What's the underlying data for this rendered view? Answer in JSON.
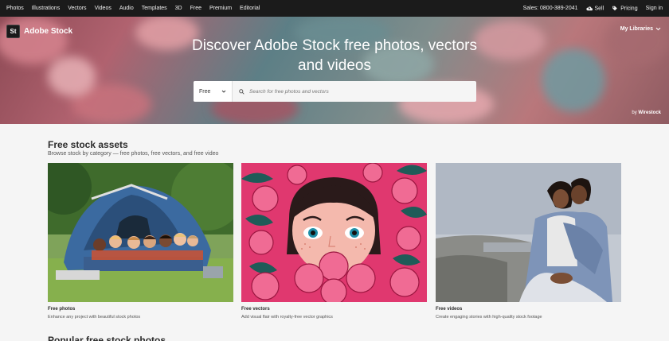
{
  "topnav": {
    "left": [
      "Photos",
      "Illustrations",
      "Vectors",
      "Videos",
      "Audio",
      "Templates",
      "3D",
      "Free",
      "Premium",
      "Editorial"
    ],
    "sales": "Sales: 0800-389-2041",
    "sell": "Sell",
    "pricing": "Pricing",
    "signin": "Sign in"
  },
  "brand": {
    "badge": "St",
    "name": "Adobe Stock"
  },
  "libraries": "My Libraries",
  "hero": {
    "title": "Discover Adobe Stock free photos, vectors and videos",
    "credit_by": "by",
    "credit_name": "Wirestock"
  },
  "search": {
    "filter": "Free",
    "placeholder": "Search for free photos and vectors"
  },
  "section": {
    "title": "Free stock assets",
    "subtitle": "Browse stock by category — free photos, free vectors, and free video"
  },
  "cards": [
    {
      "title": "Free photos",
      "desc": "Enhance any project with beautiful stock photos"
    },
    {
      "title": "Free vectors",
      "desc": "Add visual flair with royalty-free vector graphics"
    },
    {
      "title": "Free videos",
      "desc": "Create engaging stories with high-quality stock footage"
    }
  ],
  "next_section": "Popular free stock photos",
  "colors": {
    "nav_bg": "#1b1b1b",
    "page_bg": "#f5f5f5",
    "vector_pink": "#e0386f"
  }
}
